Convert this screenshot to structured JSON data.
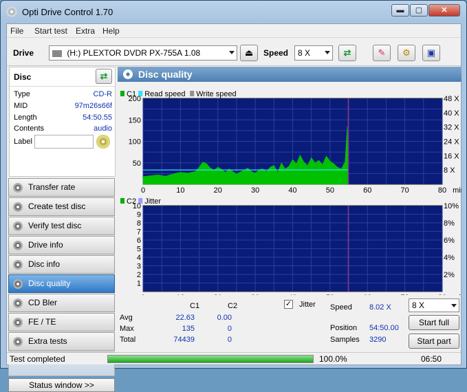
{
  "window": {
    "title": "Opti Drive Control 1.70",
    "min_label": "▬",
    "max_label": "▢",
    "close_label": "✕"
  },
  "menu": [
    "File",
    "Start test",
    "Extra",
    "Help"
  ],
  "toolbar": {
    "drive_label": "Drive",
    "drive_value": "(H:)   PLEXTOR DVDR   PX-755A 1.08",
    "speed_label": "Speed",
    "speed_value": "8 X"
  },
  "disc": {
    "title": "Disc",
    "rows": [
      {
        "key": "Type",
        "value": "CD-R"
      },
      {
        "key": "MID",
        "value": "97m26s66f"
      },
      {
        "key": "Length",
        "value": "54:50.55"
      },
      {
        "key": "Contents",
        "value": "audio"
      }
    ],
    "label_key": "Label",
    "label_value": ""
  },
  "nav": [
    {
      "label": "Transfer rate",
      "active": false
    },
    {
      "label": "Create test disc",
      "active": false
    },
    {
      "label": "Verify test disc",
      "active": false
    },
    {
      "label": "Drive info",
      "active": false
    },
    {
      "label": "Disc info",
      "active": false
    },
    {
      "label": "Disc quality",
      "active": true
    },
    {
      "label": "CD Bler",
      "active": false
    },
    {
      "label": "FE / TE",
      "active": false
    },
    {
      "label": "Extra tests",
      "active": false
    }
  ],
  "status_window_label": "Status window >>",
  "panel_title": "Disc quality",
  "chart_data": [
    {
      "type": "area",
      "legend": [
        "C1",
        "Read speed",
        "Write speed"
      ],
      "legend_colors": [
        "#00b000",
        "#33e0ff",
        "#909090"
      ],
      "xlim": [
        0,
        80
      ],
      "x_ticks": [
        0,
        10,
        20,
        30,
        40,
        50,
        60,
        70,
        80
      ],
      "x_unit": "min",
      "ylim": [
        0,
        200
      ],
      "y_ticks": [
        50,
        100,
        150,
        200
      ],
      "y2_ticks": [
        "8 X",
        "16 X",
        "24 X",
        "32 X",
        "40 X",
        "48 X"
      ],
      "y2_max": 48,
      "disc_end": 54.84,
      "series": [
        {
          "name": "C1",
          "x": [
            0,
            2,
            4,
            6,
            8,
            10,
            12,
            14,
            15,
            16,
            17,
            18,
            19,
            20,
            21,
            22,
            23,
            24,
            25,
            26,
            27,
            28,
            29,
            30,
            31,
            32,
            33,
            34,
            35,
            36,
            37,
            38,
            39,
            40,
            41,
            42,
            43,
            44,
            45,
            46,
            47,
            48,
            49,
            50,
            51,
            52,
            53,
            54,
            54.6,
            54.84
          ],
          "y": [
            18,
            20,
            22,
            19,
            24,
            28,
            26,
            30,
            40,
            52,
            48,
            38,
            33,
            40,
            35,
            28,
            36,
            30,
            24,
            29,
            33,
            38,
            30,
            26,
            34,
            36,
            30,
            40,
            44,
            28,
            50,
            36,
            42,
            58,
            48,
            68,
            52,
            44,
            62,
            50,
            56,
            46,
            66,
            54,
            48,
            40,
            36,
            52,
            135,
            40
          ]
        },
        {
          "name": "Read speed",
          "x": [
            0,
            54.84
          ],
          "y": [
            8.0,
            8.05
          ]
        }
      ]
    },
    {
      "type": "area",
      "legend": [
        "C2",
        "Jitter"
      ],
      "legend_colors": [
        "#00b000",
        "#9a9aff"
      ],
      "xlim": [
        0,
        80
      ],
      "x_ticks": [
        0,
        10,
        20,
        30,
        40,
        50,
        60,
        70,
        80
      ],
      "x_unit": "min",
      "ylim": [
        0,
        10
      ],
      "y_ticks": [
        1,
        2,
        3,
        4,
        5,
        6,
        7,
        8,
        9,
        10
      ],
      "y2_ticks": [
        "2%",
        "4%",
        "6%",
        "8%",
        "10%"
      ],
      "disc_end": 54.84,
      "series": [
        {
          "name": "C2",
          "x": [
            0,
            54.84
          ],
          "y": [
            0,
            0
          ]
        }
      ]
    }
  ],
  "stats": {
    "col_c1": "C1",
    "col_c2": "C2",
    "rows": [
      {
        "label": "Avg",
        "c1": "22.63",
        "c2": "0.00"
      },
      {
        "label": "Max",
        "c1": "135",
        "c2": "0"
      },
      {
        "label": "Total",
        "c1": "74439",
        "c2": "0"
      }
    ],
    "jitter_label": "Jitter",
    "jitter_checked": true,
    "speed_label": "Speed",
    "speed_value": "8.02 X",
    "position_label": "Position",
    "position_value": "54:50.00",
    "samples_label": "Samples",
    "samples_value": "3290",
    "speed_select": "8 X",
    "start_full": "Start full",
    "start_part": "Start part"
  },
  "status": {
    "text": "Test completed",
    "progress": 100,
    "progress_label": "100.0%",
    "time": "06:50"
  },
  "colors": {
    "plot_bg": "#0a1c7a",
    "c1": "#00c000",
    "read_speed": "#33e0ff",
    "disc_end": "#c0307a"
  }
}
